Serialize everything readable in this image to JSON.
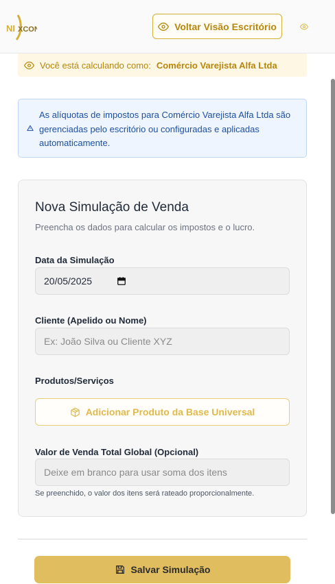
{
  "header": {
    "logo_text": "NIXCON",
    "back_button_label": "Voltar Visão Escritório",
    "icons": {
      "back": "eye-icon",
      "corner": "eye-icon"
    }
  },
  "calc_banner": {
    "prefix": "Você está calculando como:",
    "company": "Comércio Varejista Alfa Ltda",
    "icon": "eye-icon"
  },
  "info_box": {
    "text": "As alíquotas de impostos para Comércio Varejista Alfa Ltda são gerenciadas pelo escritório ou configuradas e aplicadas automaticamente.",
    "icon": "warning-icon"
  },
  "form": {
    "title": "Nova Simulação de Venda",
    "subtitle": "Preencha os dados para calcular os impostos e o lucro.",
    "date_label": "Data da Simulação",
    "date_value": "20/05/2025",
    "client_label": "Cliente (Apelido ou Nome)",
    "client_placeholder": "Ex: João Silva ou Cliente XYZ",
    "products_label": "Produtos/Serviços",
    "add_product_label": "Adicionar Produto da Base Universal",
    "total_label": "Valor de Venda Total Global (Opcional)",
    "total_placeholder": "Deixe em branco para usar soma dos itens",
    "total_hint": "Se preenchido, o valor dos itens será rateado proporcionalmente."
  },
  "footer": {
    "save_label": "Salvar Simulação",
    "icon": "save-icon"
  },
  "colors": {
    "accent": "#d4af37",
    "save_button": "#e0bd5f",
    "info_text": "#1e4fa3",
    "info_bg": "#eef5ff"
  }
}
